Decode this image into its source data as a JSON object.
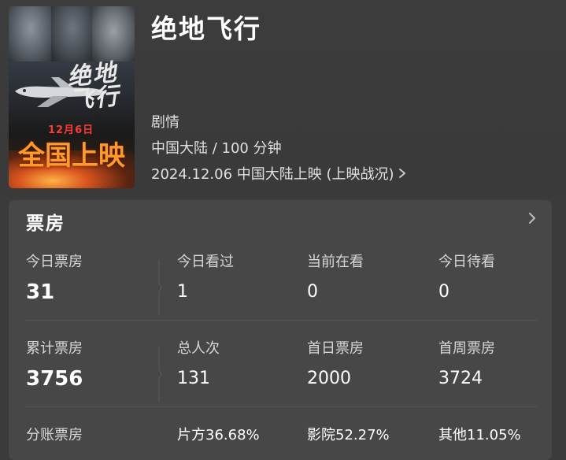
{
  "movie": {
    "title": "绝地飞行",
    "genre": "剧情",
    "region_duration": "中国大陆 / 100 分钟",
    "release": "2024.12.06 中国大陆上映 (上映战况)",
    "poster": {
      "calligraphy": "绝地飞行",
      "date_tag": "12月6日",
      "release_text": "全国上映"
    }
  },
  "box_office": {
    "section_title": "票房",
    "row1": [
      {
        "label": "今日票房",
        "value": "31"
      },
      {
        "label": "今日看过",
        "value": "1"
      },
      {
        "label": "当前在看",
        "value": "0"
      },
      {
        "label": "今日待看",
        "value": "0"
      }
    ],
    "row2": [
      {
        "label": "累计票房",
        "value": "3756"
      },
      {
        "label": "总人次",
        "value": "131"
      },
      {
        "label": "首日票房",
        "value": "2000"
      },
      {
        "label": "首周票房",
        "value": "3724"
      }
    ],
    "row3": {
      "label": "分账票房",
      "items": [
        "片方36.68%",
        "影院52.27%",
        "其他11.05%"
      ]
    }
  },
  "icons": {
    "release_chevron": "chevron-right-icon",
    "card_chevron": "chevron-right-icon"
  }
}
